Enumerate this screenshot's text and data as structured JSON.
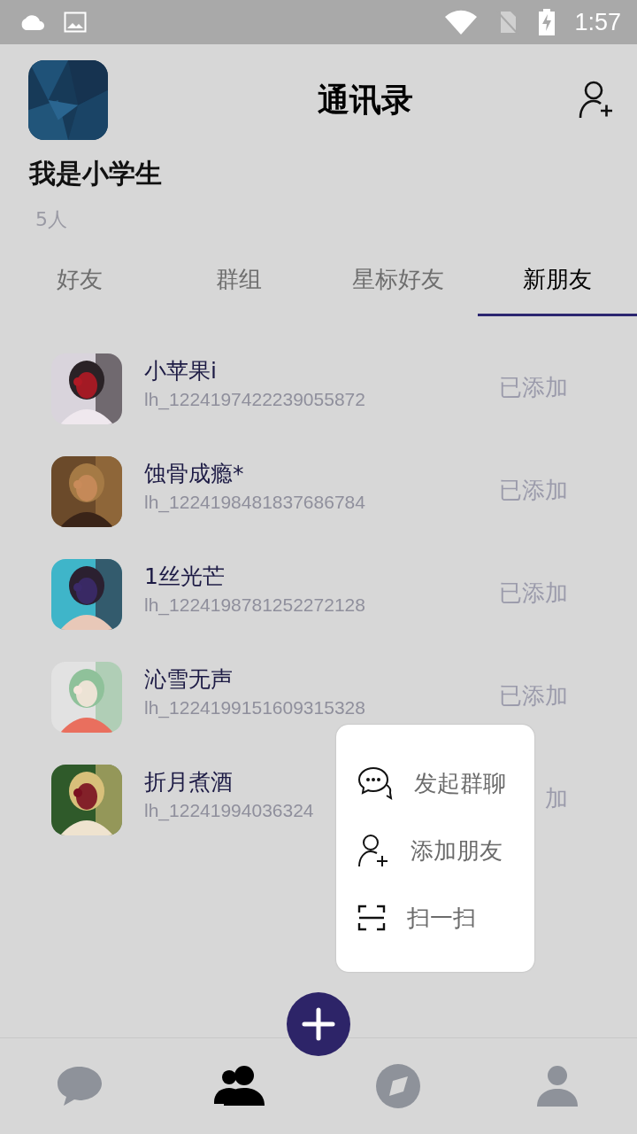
{
  "status_bar": {
    "time": "1:57"
  },
  "header": {
    "title": "通讯录",
    "user_name": "我是小学生",
    "member_count": "5人"
  },
  "tabs": [
    {
      "label": "好友",
      "selected": false
    },
    {
      "label": "群组",
      "selected": false
    },
    {
      "label": "星标好友",
      "selected": false
    },
    {
      "label": "新朋友",
      "selected": true
    }
  ],
  "contacts": [
    {
      "name": "小苹果i",
      "account": "lh_1224197422239055872",
      "status": "已添加"
    },
    {
      "name": "蚀骨成瘾*",
      "account": "lh_1224198481837686784",
      "status": "已添加"
    },
    {
      "name": "1丝光芒",
      "account": "lh_1224198781252272128",
      "status": "已添加"
    },
    {
      "name": "沁雪无声",
      "account": "lh_1224199151609315328",
      "status": "已添加"
    },
    {
      "name": "折月煮酒",
      "account": "lh_12241994036324",
      "status": "加"
    }
  ],
  "popup_menu": [
    {
      "kind": "chat",
      "label": "发起群聊"
    },
    {
      "kind": "add_friend",
      "label": "添加朋友"
    },
    {
      "kind": "scan",
      "label": "扫一扫"
    }
  ],
  "bottom_nav": [
    {
      "kind": "chat",
      "selected": false
    },
    {
      "kind": "contacts",
      "selected": true
    },
    {
      "kind": "discover",
      "selected": false
    },
    {
      "kind": "profile",
      "selected": false
    }
  ]
}
